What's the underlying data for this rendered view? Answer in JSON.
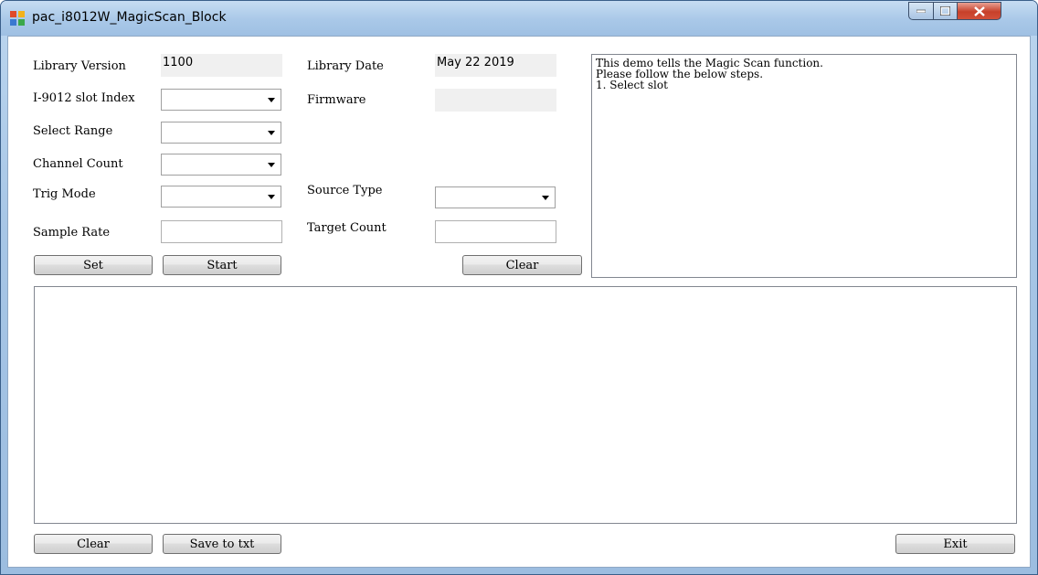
{
  "window": {
    "title": "pac_i8012W_MagicScan_Block",
    "controls": {
      "minimize": "",
      "maximize": "",
      "close": ""
    }
  },
  "form": {
    "library_version_label": "Library Version",
    "library_version_value": "1100",
    "library_date_label": "Library Date",
    "library_date_value": "May 22 2019",
    "slot_index_label": "I-9012 slot Index",
    "firmware_label": "Firmware",
    "firmware_value": "",
    "select_range_label": "Select Range",
    "channel_count_label": "Channel Count",
    "trig_mode_label": "Trig Mode",
    "source_type_label": "Source Type",
    "sample_rate_label": "Sample Rate",
    "sample_rate_value": "",
    "target_count_label": "Target Count",
    "target_count_value": ""
  },
  "buttons": {
    "set": "Set",
    "start": "Start",
    "clear_top": "Clear",
    "clear_bottom": "Clear",
    "save": "Save to txt",
    "exit": "Exit"
  },
  "info_text": "This demo tells the Magic Scan function.\nPlease follow the below steps.\n1. Select slot",
  "colors": {
    "title_bar": "#a9c8e8",
    "close_button": "#c7402a",
    "field_bg": "#f0f0f0"
  }
}
